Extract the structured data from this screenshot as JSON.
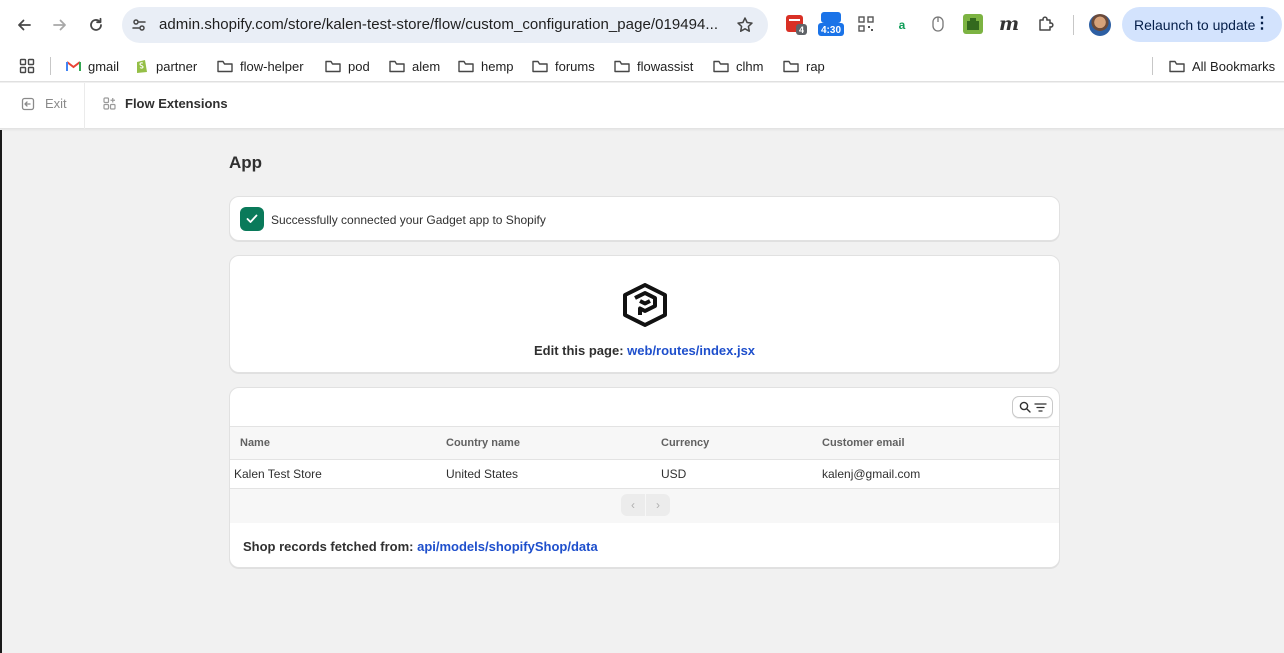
{
  "browser": {
    "url": "admin.shopify.com/store/kalen-test-store/flow/custom_configuration_page/019494...",
    "relaunch_label": "Relaunch to update",
    "extensions": [
      {
        "name": "calendar-ext-icon",
        "badge": "4"
      },
      {
        "name": "timer-ext-icon",
        "badge": "4:30"
      }
    ]
  },
  "bookmarks": [
    {
      "label": "gmail",
      "icon": "gmail-icon"
    },
    {
      "label": "partner",
      "icon": "shopify-icon"
    },
    {
      "label": "flow-helper",
      "icon": "folder-icon"
    },
    {
      "label": "pod",
      "icon": "folder-icon"
    },
    {
      "label": "alem",
      "icon": "folder-icon"
    },
    {
      "label": "hemp",
      "icon": "folder-icon"
    },
    {
      "label": "forums",
      "icon": "folder-icon"
    },
    {
      "label": "flowassist",
      "icon": "folder-icon"
    },
    {
      "label": "clhm",
      "icon": "folder-icon"
    },
    {
      "label": "rap",
      "icon": "folder-icon"
    }
  ],
  "all_bookmarks": "All Bookmarks",
  "header": {
    "exit_label": "Exit",
    "app_name": "Flow Extensions"
  },
  "page": {
    "title": "App",
    "banner_message": "Successfully connected your Gadget app to Shopify",
    "edit_prefix": "Edit this page:",
    "edit_link": "web/routes/index.jsx"
  },
  "table": {
    "columns": [
      "Name",
      "Country name",
      "Currency",
      "Customer email"
    ],
    "rows": [
      [
        "Kalen Test Store",
        "United States",
        "USD",
        "kalenj@gmail.com"
      ]
    ],
    "footer_prefix": "Shop records fetched from:",
    "footer_link": "api/models/shopifyShop/data"
  },
  "colors": {
    "success": "#0a7a5a",
    "link": "#1e4fcc",
    "relaunch_bg": "#d3e3fd",
    "page_bg": "#f1f1f1"
  }
}
